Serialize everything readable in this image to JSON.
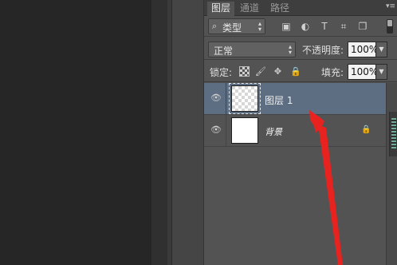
{
  "colors": {
    "panel_bg": "#535353",
    "selection": "#5d6d82",
    "arrow": "#e8231f"
  },
  "tabs": [
    {
      "label": "图层",
      "active": true
    },
    {
      "label": "通道",
      "active": false
    },
    {
      "label": "路径",
      "active": false
    }
  ],
  "panel_menu_icon": "panel-menu-icon",
  "filter": {
    "search_icon": "magnifier-icon",
    "kind_value": "类型",
    "icons": [
      "image-filter-icon",
      "adjustment-filter-icon",
      "type-filter-icon",
      "shape-filter-icon",
      "smart-object-filter-icon"
    ]
  },
  "blend": {
    "mode_value": "正常",
    "opacity_label": "不透明度:",
    "opacity_value": "100%"
  },
  "lock": {
    "label": "锁定:",
    "icons": [
      "lock-transparent-icon",
      "lock-brush-icon",
      "lock-move-icon",
      "lock-all-icon"
    ],
    "fill_label": "填充:",
    "fill_value": "100%"
  },
  "layers": [
    {
      "name": "图层 1",
      "selected": true,
      "visible": true,
      "thumbnail": "transparent"
    },
    {
      "name": "背景",
      "selected": false,
      "visible": true,
      "thumbnail": "white",
      "locked": true
    }
  ]
}
